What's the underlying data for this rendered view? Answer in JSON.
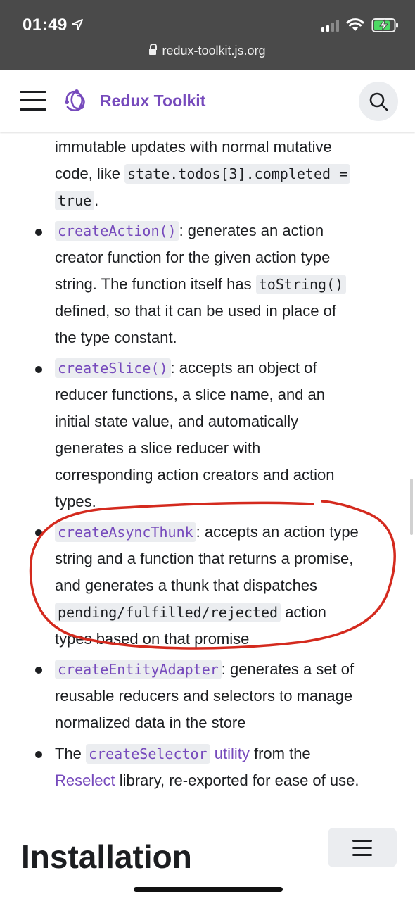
{
  "status_bar": {
    "time": "01:49",
    "url": "redux-toolkit.js.org",
    "icons": [
      "location-arrow-icon",
      "signal-icon",
      "wifi-icon",
      "battery-charging-icon"
    ]
  },
  "navbar": {
    "brand": "Redux Toolkit",
    "brand_color": "#764abc",
    "icons": [
      "hamburger-menu-icon",
      "redux-logo-icon",
      "search-icon"
    ]
  },
  "content": {
    "intro": {
      "line1": "immutable updates with normal mutative",
      "line2_prefix": "code, like ",
      "code1": "state.todos[3].completed =",
      "code2": "true",
      "suffix": "."
    },
    "items": [
      {
        "code": "createAction()",
        "text_a": ": generates an action",
        "text_b": "creator function for the given action type",
        "text_c": "string. The function itself has ",
        "code2": "toString()",
        "text_d": "defined, so that it can be used in place of",
        "text_e": "the type constant."
      },
      {
        "code": "createSlice()",
        "text_a": ": accepts an object of",
        "text_b": "reducer functions, a slice name, and an",
        "text_c": "initial state value, and automatically",
        "text_d": "generates a slice reducer with",
        "text_e": "corresponding action creators and action",
        "text_f": "types."
      },
      {
        "code": "createAsyncThunk",
        "text_a": ": accepts an action type",
        "text_b": "string and a function that returns a promise,",
        "text_c": "and generates a thunk that dispatches",
        "code2": "pending/fulfilled/rejected",
        "text_d": " action",
        "text_e": "types based on that promise"
      },
      {
        "code": "createEntityAdapter",
        "text_a": ": generates a set of",
        "text_b": "reusable reducers and selectors to manage",
        "text_c": "normalized data in the store"
      },
      {
        "prefix": "The ",
        "code": "createSelector",
        "link1": "utility",
        "text_a": " from the",
        "link2": "Reselect",
        "text_b": " library, re-exported for ease of use."
      }
    ],
    "heading": "Installation",
    "icons": [
      "table-of-contents-icon"
    ]
  },
  "colors": {
    "link": "#764abc",
    "code_bg": "#ebedf0",
    "status_bar_bg": "#4a4a4a",
    "annotation": "#d42a1e"
  }
}
